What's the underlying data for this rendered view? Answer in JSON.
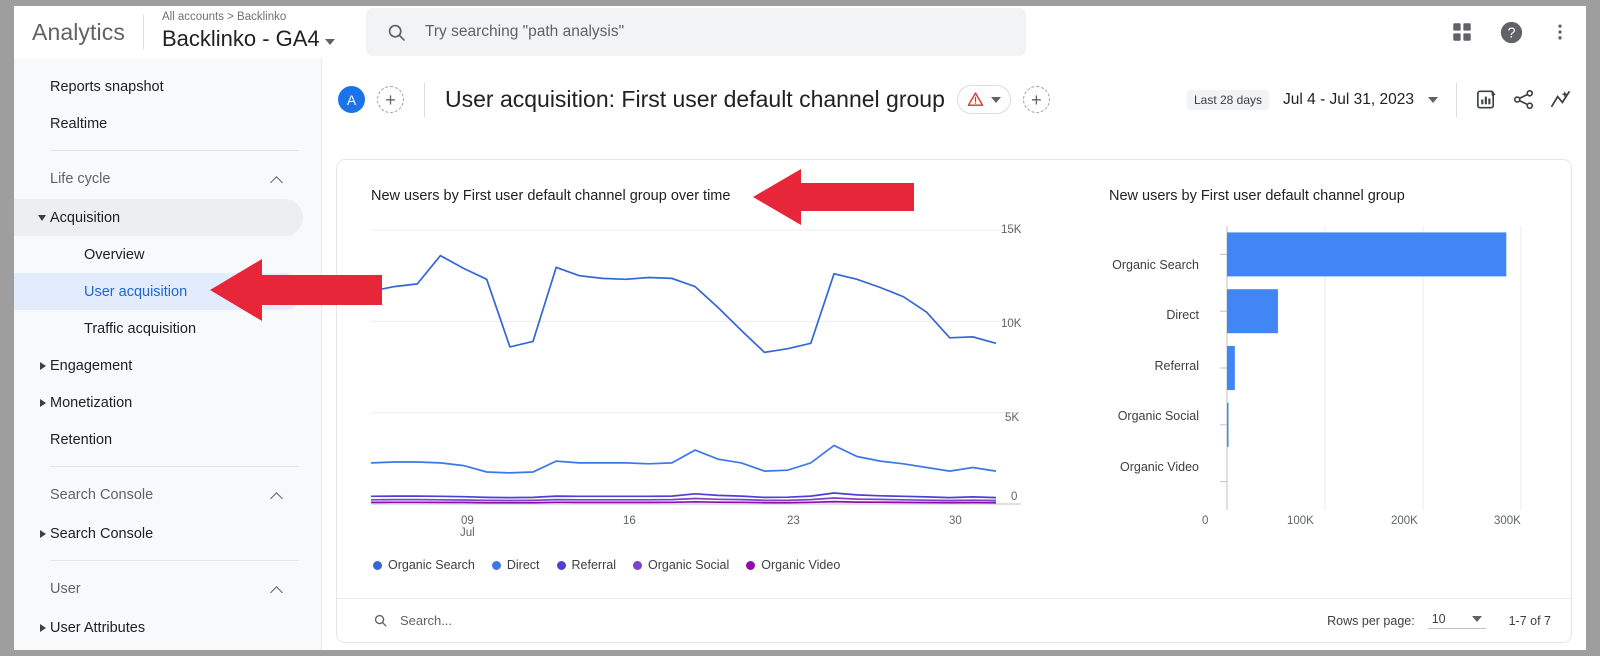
{
  "topbar": {
    "brand": "Analytics",
    "breadcrumb": "All accounts > Backlinko",
    "account": "Backlinko - GA4",
    "search_placeholder": "Try searching \"path analysis\"",
    "icons": {
      "search": "search-icon",
      "apps": "apps-grid-icon",
      "help": "help-icon",
      "more": "more-vert-icon"
    }
  },
  "sidebar": {
    "top_items": [
      {
        "label": "Reports snapshot"
      },
      {
        "label": "Realtime"
      }
    ],
    "sections": [
      {
        "title": "Life cycle",
        "items": [
          {
            "label": "Acquisition",
            "state": "expanded-active"
          },
          {
            "label": "Overview",
            "state": "sub"
          },
          {
            "label": "User acquisition",
            "state": "sub-selected"
          },
          {
            "label": "Traffic acquisition",
            "state": "sub"
          },
          {
            "label": "Engagement",
            "state": "collapsed"
          },
          {
            "label": "Monetization",
            "state": "collapsed"
          },
          {
            "label": "Retention",
            "state": "plain"
          }
        ]
      },
      {
        "title": "Search Console",
        "items": [
          {
            "label": "Search Console",
            "state": "collapsed"
          }
        ]
      },
      {
        "title": "User",
        "items": [
          {
            "label": "User Attributes",
            "state": "collapsed"
          }
        ]
      }
    ]
  },
  "report": {
    "avatar_initial": "A",
    "add_label": "+",
    "title": "User acquisition: First user default channel group",
    "warning_icon": "warning-triangle-icon",
    "date_chip": "Last 28 days",
    "date_range": "Jul 4 - Jul 31, 2023",
    "actions": [
      "edit-report-icon",
      "share-icon",
      "insights-icon"
    ]
  },
  "card": {
    "footer_search_placeholder": "Search...",
    "rows_per_page_label": "Rows per page:",
    "rows_per_page_value": "10",
    "pagination": "1-7 of 7"
  },
  "chart_data": [
    {
      "type": "line",
      "title": "New users by First user default channel group over time",
      "xlabel": "",
      "ylabel": "",
      "ylim": [
        0,
        15000
      ],
      "yticks": [
        0,
        5000,
        10000,
        15000
      ],
      "ytick_labels": [
        "0",
        "5K",
        "10K",
        "15K"
      ],
      "x": [
        "Jul 4",
        "Jul 5",
        "Jul 6",
        "Jul 7",
        "Jul 8",
        "Jul 9",
        "Jul 10",
        "Jul 11",
        "Jul 12",
        "Jul 13",
        "Jul 14",
        "Jul 15",
        "Jul 16",
        "Jul 17",
        "Jul 18",
        "Jul 19",
        "Jul 20",
        "Jul 21",
        "Jul 22",
        "Jul 23",
        "Jul 24",
        "Jul 25",
        "Jul 26",
        "Jul 27",
        "Jul 28",
        "Jul 29",
        "Jul 30",
        "Jul 31"
      ],
      "xtick_labels": [
        "09\nJul",
        "16",
        "23",
        "30"
      ],
      "xtick_positions": [
        5,
        12,
        19,
        26
      ],
      "grid": true,
      "legend_position": "bottom",
      "series": [
        {
          "name": "Organic Search",
          "color": "#3367d6",
          "values": [
            11650,
            11900,
            12050,
            13600,
            12900,
            12300,
            8600,
            8900,
            12950,
            12500,
            12350,
            12300,
            12400,
            12350,
            11900,
            10750,
            9500,
            8300,
            8500,
            8800,
            12600,
            12300,
            11850,
            11350,
            10500,
            9100,
            9150,
            8800
          ]
        },
        {
          "name": "Direct",
          "color": "#3b78e7",
          "values": [
            2250,
            2300,
            2300,
            2250,
            2100,
            1750,
            1700,
            1750,
            2350,
            2250,
            2250,
            2250,
            2200,
            2250,
            2950,
            2450,
            2250,
            1800,
            1850,
            2250,
            3200,
            2600,
            2350,
            2200,
            2000,
            1800,
            2000,
            1800
          ]
        },
        {
          "name": "Referral",
          "color": "#4c3fd6",
          "values": [
            420,
            430,
            430,
            420,
            400,
            360,
            350,
            360,
            430,
            420,
            420,
            420,
            420,
            430,
            560,
            470,
            430,
            360,
            370,
            430,
            600,
            500,
            450,
            420,
            390,
            350,
            390,
            350
          ]
        },
        {
          "name": "Organic Social",
          "color": "#7b43cc",
          "values": [
            230,
            240,
            240,
            230,
            220,
            200,
            190,
            200,
            240,
            230,
            230,
            230,
            230,
            240,
            300,
            260,
            240,
            200,
            200,
            240,
            330,
            270,
            250,
            230,
            210,
            190,
            210,
            190
          ]
        },
        {
          "name": "Organic Video",
          "color": "#8e0fa8",
          "values": [
            90,
            95,
            95,
            90,
            85,
            75,
            72,
            75,
            95,
            90,
            90,
            90,
            90,
            95,
            120,
            100,
            95,
            75,
            78,
            95,
            130,
            105,
            98,
            90,
            82,
            75,
            82,
            75
          ]
        }
      ]
    },
    {
      "type": "bar",
      "orientation": "horizontal",
      "title": "New users by First user default channel group",
      "categories": [
        "Organic Search",
        "Direct",
        "Referral",
        "Organic Social",
        "Organic Video"
      ],
      "values": [
        285000,
        52000,
        8000,
        1000,
        0
      ],
      "xlim": [
        0,
        300000
      ],
      "xticks": [
        0,
        100000,
        200000,
        300000
      ],
      "xtick_labels": [
        "0",
        "100K",
        "200K",
        "300K"
      ],
      "bar_color": "#4285f4",
      "grid": true
    }
  ],
  "annotations": {
    "arrow_chart_title": "red-arrow-pointing-left",
    "arrow_sidebar": "red-arrow-pointing-left"
  }
}
